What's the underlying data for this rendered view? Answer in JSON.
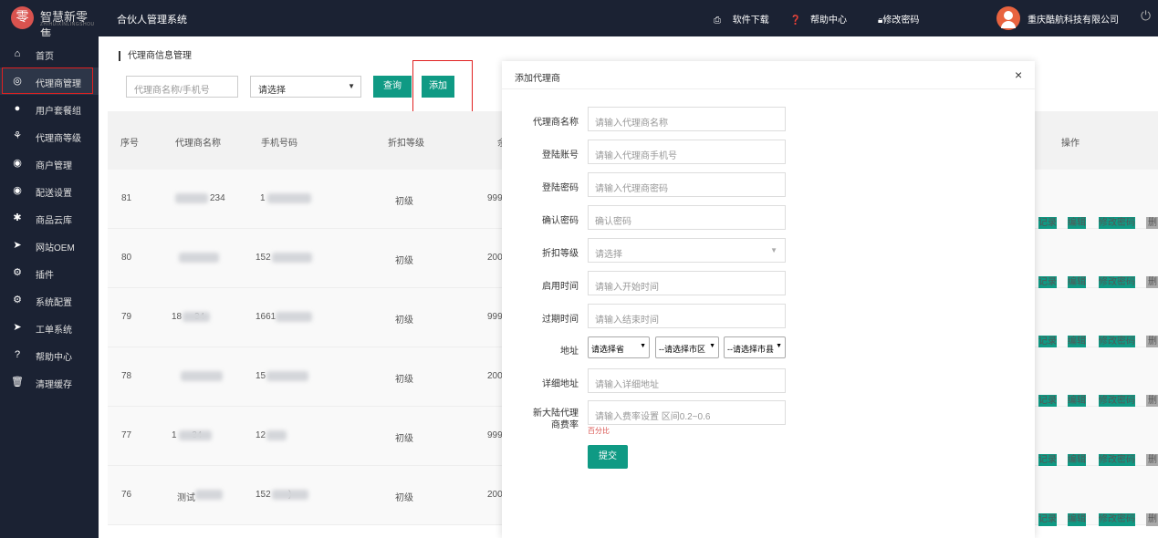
{
  "app": {
    "logo_mark": "零",
    "logo_text": "智慧新零售",
    "logo_sub": "ZHIHUIXINLINGSHOU",
    "system_title": "合伙人管理系统",
    "company": "重庆酷航科技有限公司"
  },
  "header": {
    "download": "软件下载",
    "help": "帮助中心",
    "change_password": "修改密码",
    "icons": {
      "download": "download-icon",
      "help": "question-circle-icon",
      "password": "lock-icon",
      "power": "power-icon"
    }
  },
  "sidebar": {
    "items": [
      {
        "label": "首页",
        "icon": "home-icon"
      },
      {
        "label": "代理商管理",
        "icon": "agent-icon"
      },
      {
        "label": "用户套餐组",
        "icon": "package-icon"
      },
      {
        "label": "代理商等级",
        "icon": "level-icon"
      },
      {
        "label": "商户管理",
        "icon": "user-circle-icon"
      },
      {
        "label": "配送设置",
        "icon": "user-circle-icon"
      },
      {
        "label": "商品云库",
        "icon": "asterisk-icon"
      },
      {
        "label": "网站OEM",
        "icon": "send-icon"
      },
      {
        "label": "插件",
        "icon": "cogs-icon"
      },
      {
        "label": "系统配置",
        "icon": "cogs-icon"
      },
      {
        "label": "工单系统",
        "icon": "send-icon"
      },
      {
        "label": "帮助中心",
        "icon": "question-circle-icon"
      },
      {
        "label": "清理缓存",
        "icon": "trash-icon"
      }
    ]
  },
  "page": {
    "breadcrumb": "代理商信息管理"
  },
  "filter": {
    "placeholder": "代理商名称/手机号",
    "select_value": "请选择",
    "query_label": "查询",
    "add_label": "添加"
  },
  "table": {
    "headers": {
      "index": "序号",
      "name": "代理商名称",
      "phone": "手机号码",
      "level": "折扣等级",
      "extra": "余",
      "ops": "操作"
    },
    "rows": [
      {
        "id": "81",
        "name_visible": "234",
        "phone_visible": "1",
        "level": "初级",
        "extra": "999"
      },
      {
        "id": "80",
        "name_visible": "",
        "phone_visible": "152",
        "level": "初级",
        "extra": "200"
      },
      {
        "id": "79",
        "name_visible": "18     34",
        "phone_visible": "1661",
        "level": "初级",
        "extra": "999"
      },
      {
        "id": "78",
        "name_visible": "",
        "phone_visible": "15",
        "level": "初级",
        "extra": "200"
      },
      {
        "id": "77",
        "name_visible": "1      34",
        "phone_visible": "12",
        "level": "初级",
        "extra": "999"
      },
      {
        "id": "76",
        "name_visible": "测试",
        "phone_visible": "152       )",
        "level": "初级",
        "extra": "200"
      }
    ],
    "ops": {
      "record": "记录",
      "edit": "编辑",
      "change_pwd": "修改密码",
      "delete": "删"
    }
  },
  "modal": {
    "title": "添加代理商",
    "close": "×",
    "fields": [
      {
        "label": "代理商名称",
        "placeholder": "请输入代理商名称"
      },
      {
        "label": "登陆账号",
        "placeholder": "请输入代理商手机号"
      },
      {
        "label": "登陆密码",
        "placeholder": "请输入代理商密码"
      },
      {
        "label": "确认密码",
        "placeholder": "确认密码"
      },
      {
        "label": "折扣等级",
        "placeholder": "请选择"
      },
      {
        "label": "启用时间",
        "placeholder": "请输入开始时间"
      },
      {
        "label": "过期时间",
        "placeholder": "请输入结束时间"
      }
    ],
    "address": {
      "label": "地址",
      "province": "请选择省",
      "city": "--请选择市区",
      "county": "--请选择市县"
    },
    "detail_address": {
      "label": "详细地址",
      "placeholder": "请输入详细地址"
    },
    "rate": {
      "label_line1": "新大陆代理",
      "label_line2": "商费率",
      "placeholder": "请输入费率设置 区间0.2~0.6",
      "hint": "百分比"
    },
    "submit": "提交"
  },
  "colors": {
    "sidebar_bg": "#1b2233",
    "accent": "#0f9a84",
    "highlight": "#e02020"
  }
}
